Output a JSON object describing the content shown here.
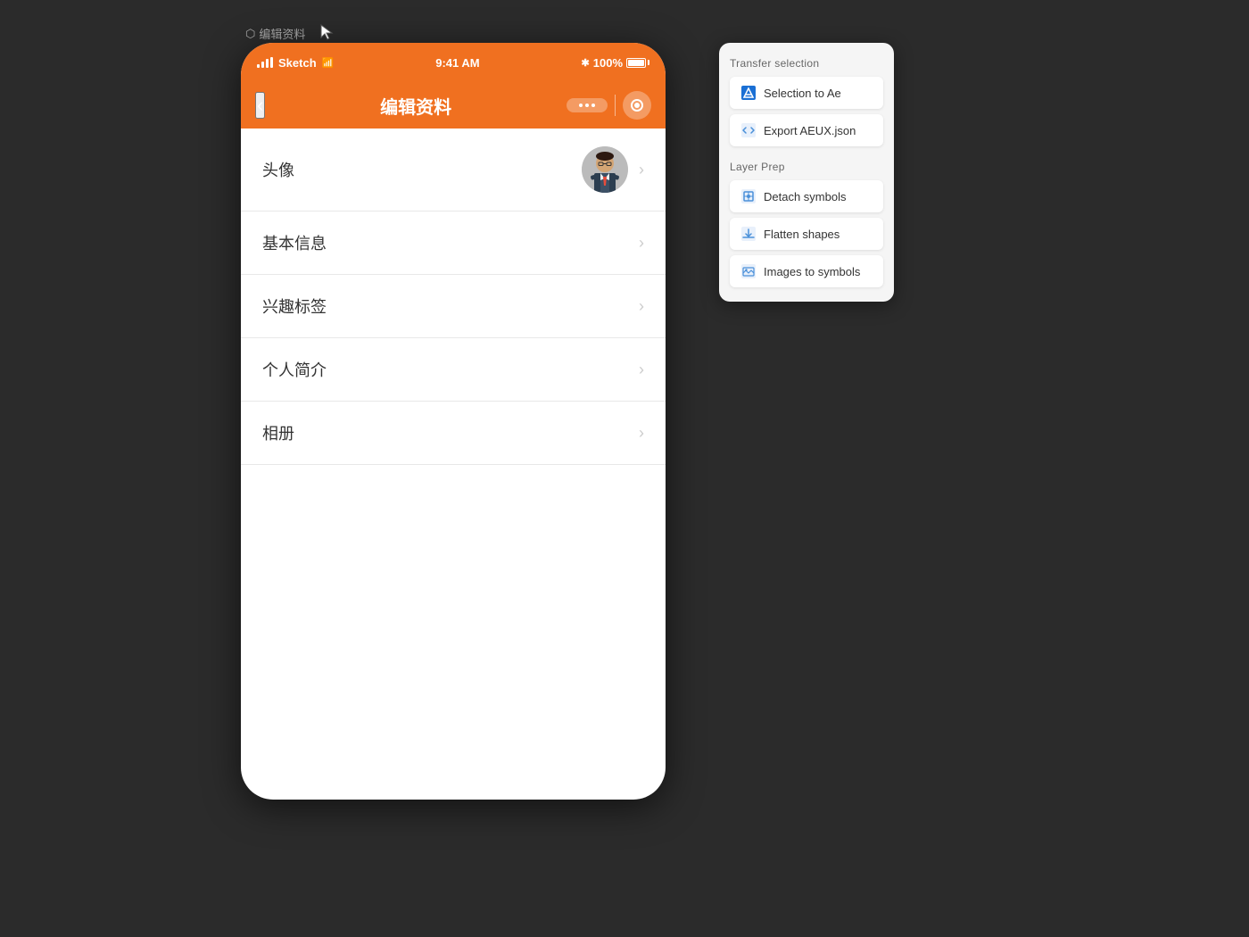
{
  "sketch_label": "编辑资料",
  "cursor_label": "cursor",
  "status_bar": {
    "time": "9:41 AM",
    "signal_label": "signal",
    "bluetooth": "✱",
    "battery_percent": "100%"
  },
  "nav_bar": {
    "back_icon": "‹",
    "title": "编辑资料",
    "more_label": "•••",
    "record_label": "record"
  },
  "menu_items": [
    {
      "label": "头像",
      "has_avatar": true
    },
    {
      "label": "基本信息",
      "has_avatar": false
    },
    {
      "label": "兴趣标签",
      "has_avatar": false
    },
    {
      "label": "个人简介",
      "has_avatar": false
    },
    {
      "label": "相册",
      "has_avatar": false
    }
  ],
  "plugin_panel": {
    "transfer_section_title": "Transfer selection",
    "layer_prep_title": "Layer Prep",
    "buttons": {
      "selection_to_ae": "Selection to Ae",
      "export_aeux": "Export AEUX.json",
      "detach_symbols": "Detach symbols",
      "flatten_shapes": "Flatten shapes",
      "images_to_symbols": "Images to symbols"
    }
  },
  "colors": {
    "orange": "#f07020",
    "blue": "#4a90d9",
    "panel_bg": "#f5f5f5",
    "white": "#ffffff"
  }
}
